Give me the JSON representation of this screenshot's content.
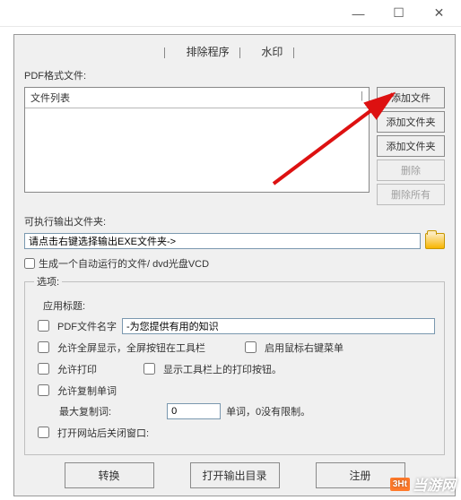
{
  "titlebar": {
    "min": "—",
    "max": "☐",
    "close": "✕"
  },
  "tabs": {
    "exclude": "排除程序",
    "watermark": "水印"
  },
  "labels": {
    "pdf_files": "PDF格式文件:",
    "file_list_header": "文件列表",
    "output_folder": "可执行输出文件夹:",
    "output_placeholder": "请点击右键选择输出EXE文件夹->",
    "auto_run_file": "生成一个自动运行的文件/ dvd光盘VCD",
    "options_legend": "选项:",
    "app_title": "应用标题:",
    "pdf_name": "PDF文件名字",
    "pdf_name_value": "-为您提供有用的知识",
    "allow_fullscreen": "允许全屏显示，全屏按钮在工具栏",
    "enable_right_click": "启用鼠标右键菜单",
    "allow_print": "允许打印",
    "show_print_btn": "显示工具栏上的打印按钮。",
    "allow_copy": "允许复制单词",
    "max_copy": "最大复制词:",
    "max_copy_value": "0",
    "max_copy_hint": "单词，0没有限制。",
    "close_window": "打开网站后关闭窗口:"
  },
  "buttons": {
    "add_file": "添加文件",
    "add_dir": "添加文件夹",
    "add_dir2": "添加文件夹",
    "delete": "删除",
    "delete_all": "删除所有",
    "convert": "转换",
    "open_output": "打开输出目录",
    "register": "注册"
  },
  "watermark": {
    "logo": "3Ht",
    "text": "当游网"
  }
}
